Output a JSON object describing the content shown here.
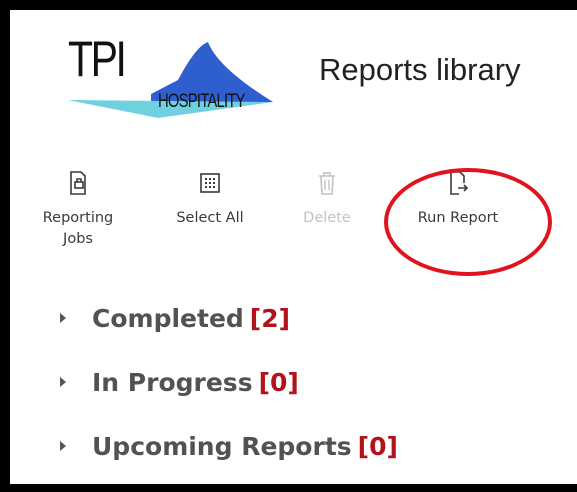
{
  "header": {
    "logo_text": "TPI",
    "logo_subtext": "HOSPITALITY",
    "title": "Reports library"
  },
  "toolbar": [
    {
      "label_line1": "Reporting",
      "label_line2": "Jobs",
      "icon": "reporting-jobs-icon",
      "enabled": true
    },
    {
      "label_line1": "Select All",
      "label_line2": "",
      "icon": "select-all-icon",
      "enabled": true
    },
    {
      "label_line1": "Delete",
      "label_line2": "",
      "icon": "trash-icon",
      "enabled": false
    },
    {
      "label_line1": "Run Report",
      "label_line2": "",
      "icon": "run-report-icon",
      "enabled": true
    }
  ],
  "sections": [
    {
      "label": "Completed",
      "count": "[2]"
    },
    {
      "label": "In Progress",
      "count": "[0]"
    },
    {
      "label": "Upcoming Reports",
      "count": "[0]"
    }
  ],
  "colors": {
    "highlight": "#e0141e",
    "count_red": "#b3121b",
    "logo_blue": "#2f5fcf",
    "logo_cyan": "#6fd0e0"
  }
}
